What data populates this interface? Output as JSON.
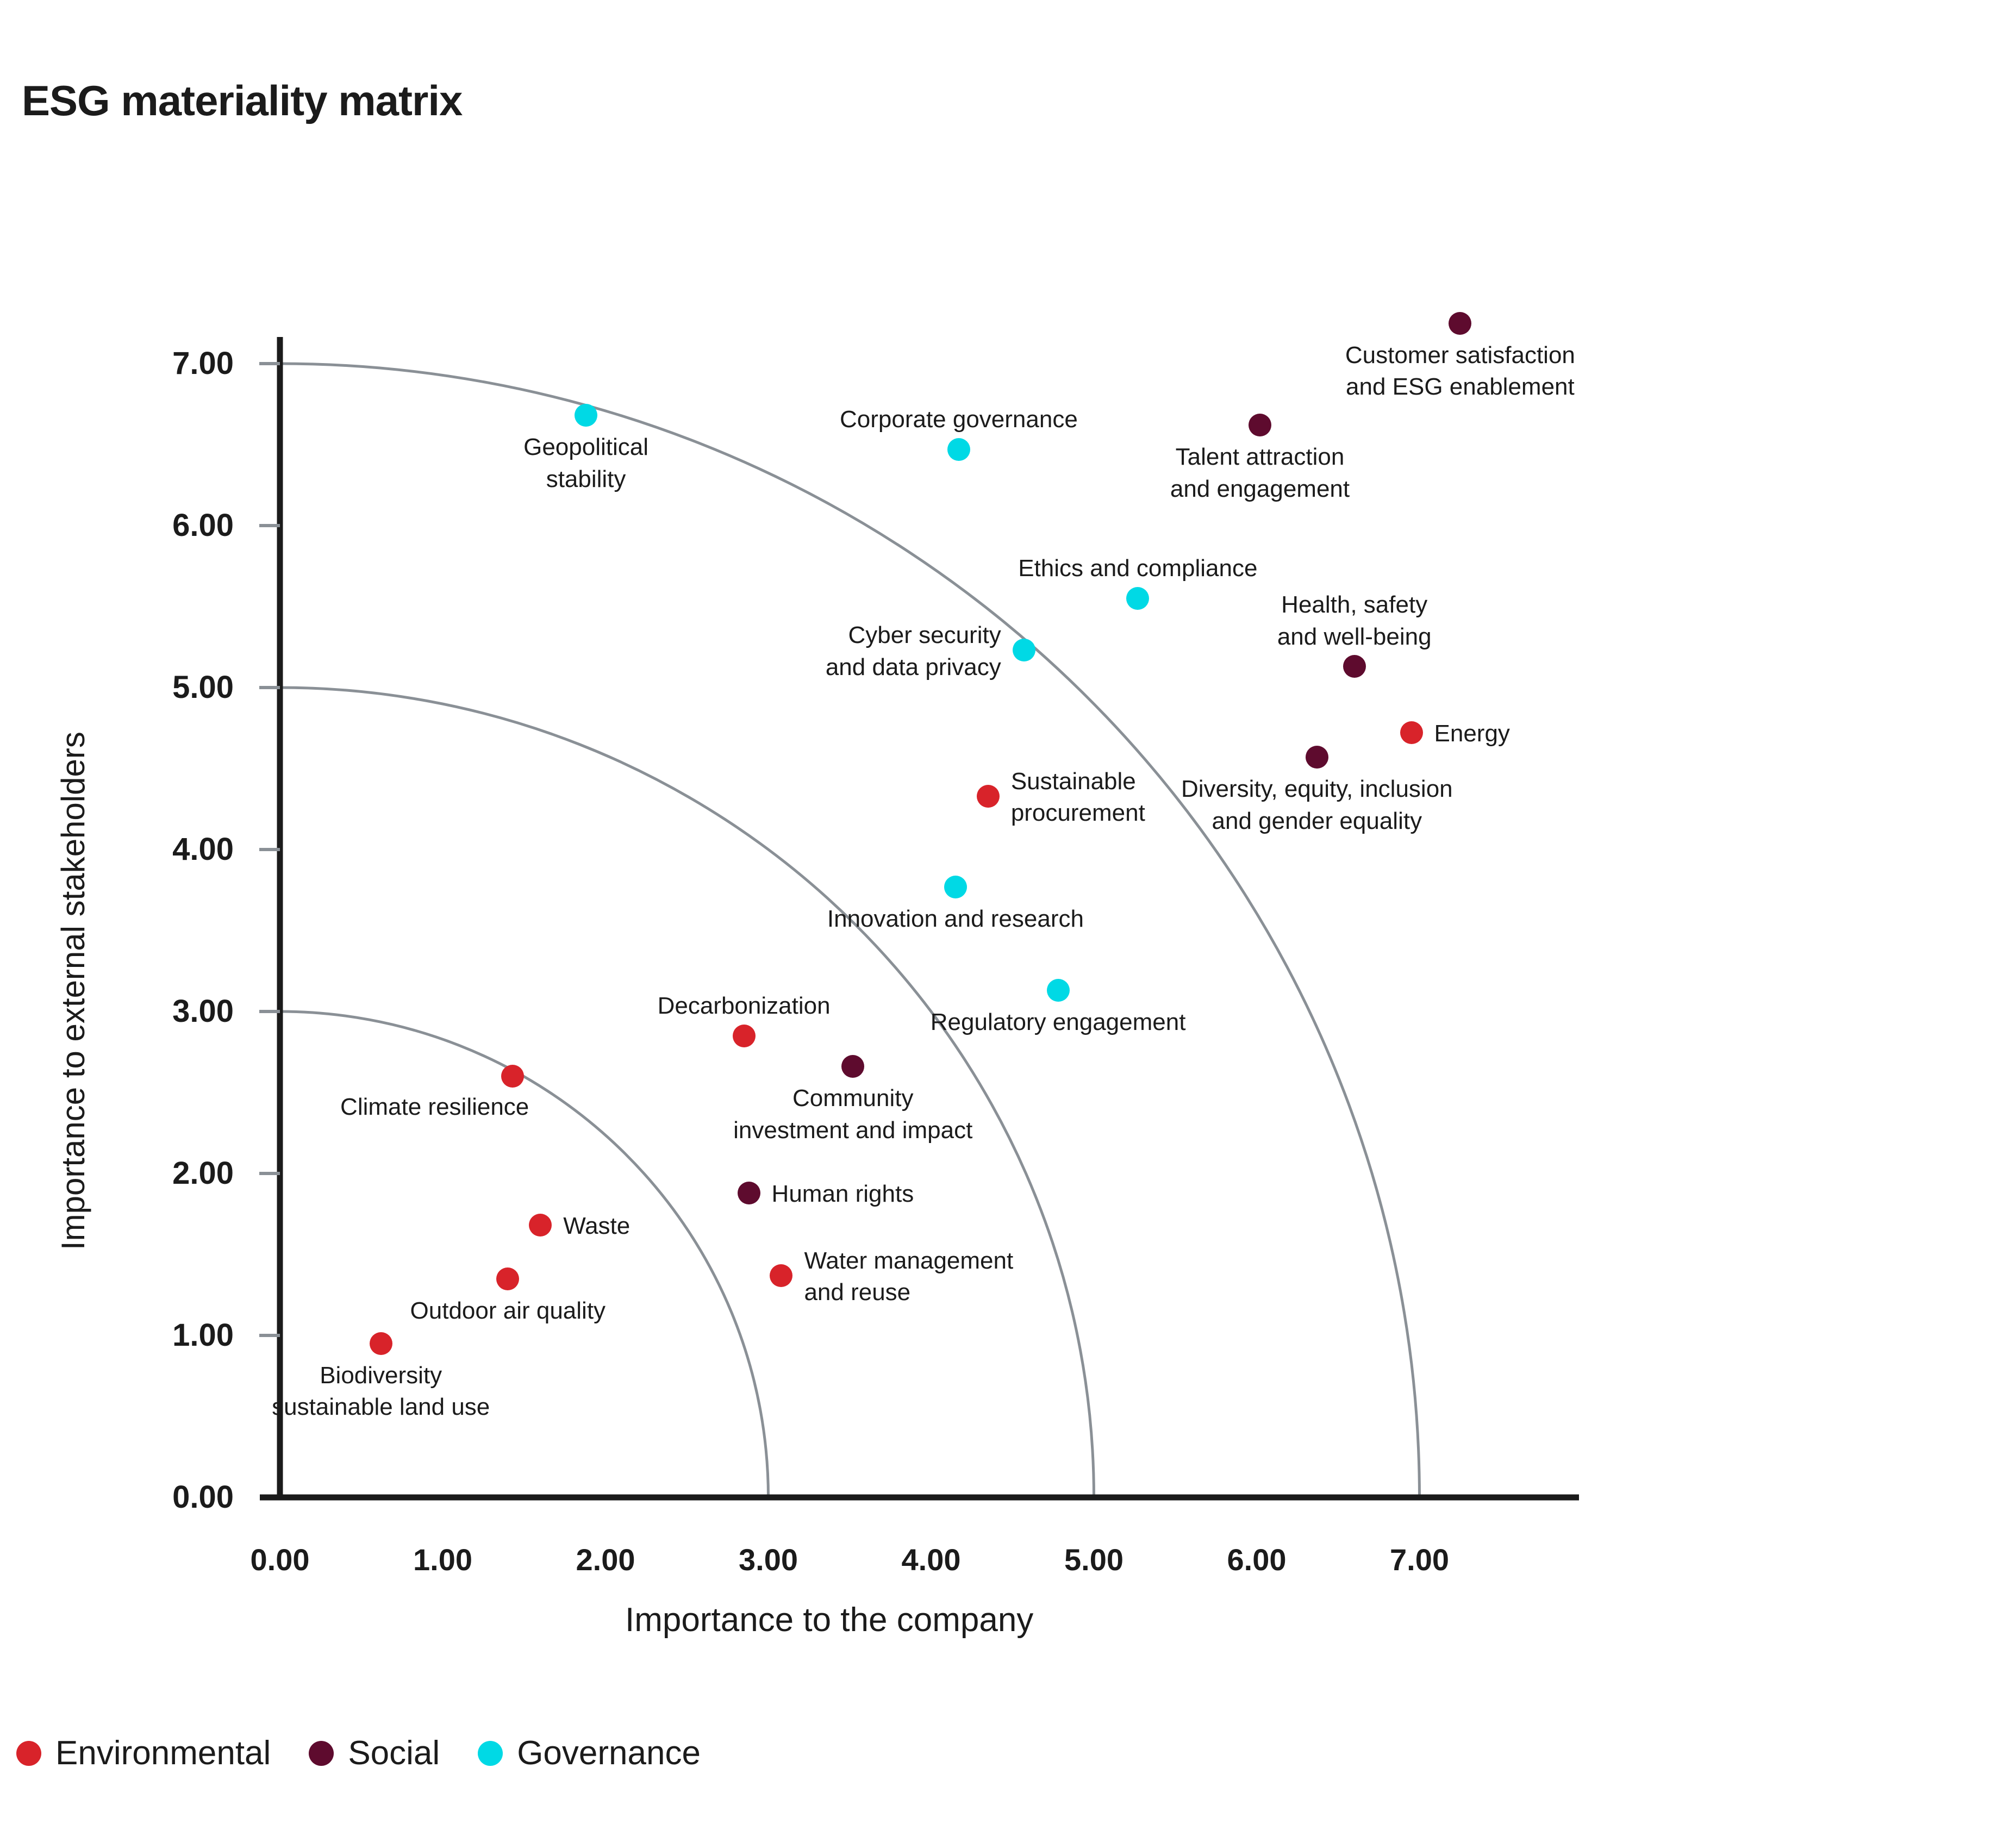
{
  "chart_data": {
    "type": "scatter",
    "title": "ESG materiality matrix",
    "xlabel": "Importance to the company",
    "ylabel": "Importance to external stakeholders",
    "xlim": [
      0,
      7.8
    ],
    "ylim": [
      0,
      7.6
    ],
    "grid": false,
    "legend_position": "bottom-left",
    "x_ticks": [
      "0.00",
      "1.00",
      "2.00",
      "3.00",
      "4.00",
      "5.00",
      "6.00",
      "7.00"
    ],
    "y_ticks": [
      "0.00",
      "1.00",
      "2.00",
      "3.00",
      "4.00",
      "5.00",
      "6.00",
      "7.00"
    ],
    "x_tick_values": [
      0,
      1,
      2,
      3,
      4,
      5,
      6,
      7
    ],
    "y_tick_values": [
      0,
      1,
      2,
      3,
      4,
      5,
      6,
      7
    ],
    "arcs": [
      3.0,
      5.0,
      7.0
    ],
    "arc_color": "#8a9096",
    "series": [
      {
        "name": "Environmental",
        "color": "#D8232A",
        "points": [
          {
            "label": "Energy",
            "x": 6.95,
            "y": 4.72,
            "label_pos": "right"
          },
          {
            "label": "Sustainable\nprocurement",
            "x": 4.35,
            "y": 4.33,
            "label_pos": "right"
          },
          {
            "label": "Decarbonization",
            "x": 2.85,
            "y": 2.85,
            "label_pos": "above"
          },
          {
            "label": "Climate resilience",
            "x": 1.43,
            "y": 2.6,
            "label_pos": "below-left"
          },
          {
            "label": "Waste",
            "x": 1.6,
            "y": 1.68,
            "label_pos": "right"
          },
          {
            "label": "Outdoor air quality",
            "x": 1.4,
            "y": 1.35,
            "label_pos": "below"
          },
          {
            "label": "Water management\nand reuse",
            "x": 3.08,
            "y": 1.37,
            "label_pos": "right"
          },
          {
            "label": "Biodiversity\nsustainable land use",
            "x": 0.62,
            "y": 0.95,
            "label_pos": "below"
          }
        ]
      },
      {
        "name": "Social",
        "color": "#5E0B2E",
        "points": [
          {
            "label": "Customer satisfaction\nand ESG enablement",
            "x": 7.25,
            "y": 7.25,
            "label_pos": "below"
          },
          {
            "label": "Talent attraction\nand engagement",
            "x": 6.02,
            "y": 6.62,
            "label_pos": "below"
          },
          {
            "label": "Health, safety\nand well-being",
            "x": 6.6,
            "y": 5.13,
            "label_pos": "above"
          },
          {
            "label": "Diversity, equity, inclusion\nand gender equality",
            "x": 6.37,
            "y": 4.57,
            "label_pos": "below"
          },
          {
            "label": "Community\ninvestment and impact",
            "x": 3.52,
            "y": 2.66,
            "label_pos": "below"
          },
          {
            "label": "Human rights",
            "x": 2.88,
            "y": 1.88,
            "label_pos": "right"
          }
        ]
      },
      {
        "name": "Governance",
        "color": "#00D9E5",
        "points": [
          {
            "label": "Geopolitical\nstability",
            "x": 1.88,
            "y": 6.68,
            "label_pos": "below"
          },
          {
            "label": "Corporate governance",
            "x": 4.17,
            "y": 6.47,
            "label_pos": "above"
          },
          {
            "label": "Ethics and compliance",
            "x": 5.27,
            "y": 5.55,
            "label_pos": "above"
          },
          {
            "label": "Cyber security\nand data privacy",
            "x": 4.57,
            "y": 5.23,
            "label_pos": "left"
          },
          {
            "label": "Innovation and research",
            "x": 4.15,
            "y": 3.77,
            "label_pos": "below"
          },
          {
            "label": "Regulatory engagement",
            "x": 4.78,
            "y": 3.13,
            "label_pos": "below"
          }
        ]
      }
    ]
  },
  "legend": {
    "items": [
      {
        "label": "Environmental",
        "color": "#D8232A"
      },
      {
        "label": "Social",
        "color": "#5E0B2E"
      },
      {
        "label": "Governance",
        "color": "#00D9E5"
      }
    ]
  }
}
